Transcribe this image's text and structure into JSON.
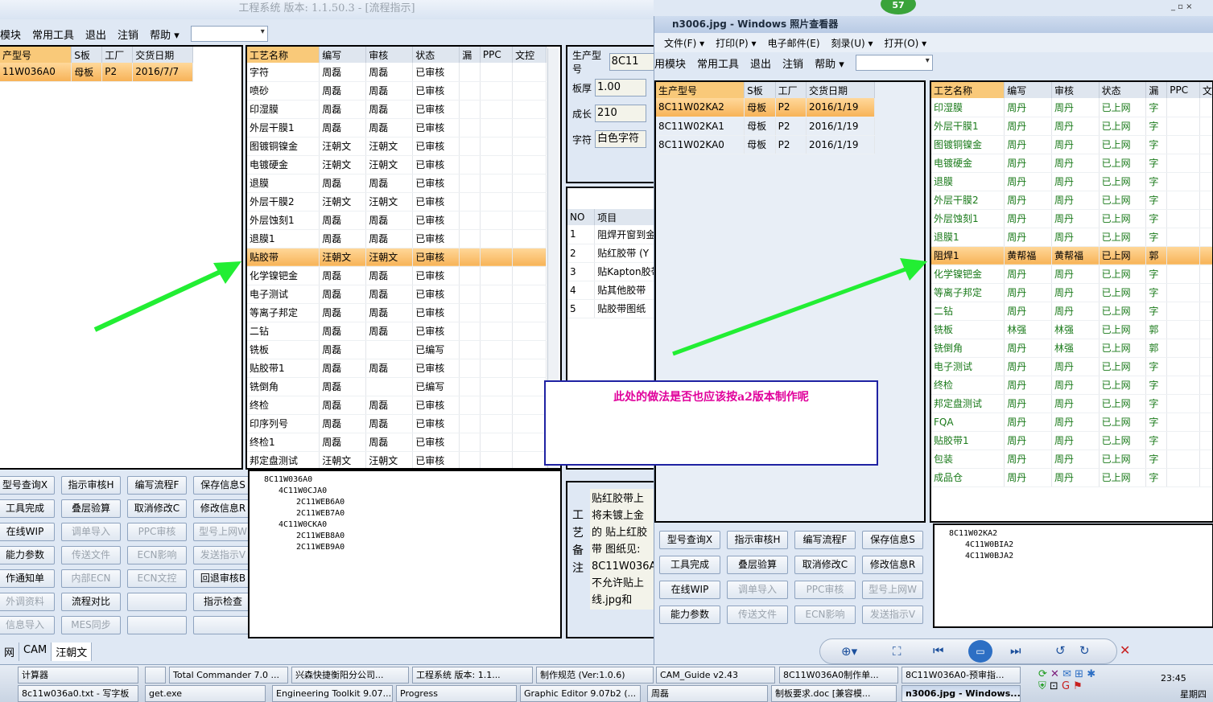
{
  "left_app": {
    "title": "工程系统  版本: 1.1.50.3 - [流程指示]",
    "menu": [
      "模块",
      "常用工具",
      "退出",
      "注销",
      "帮助 ▾"
    ],
    "order_table": {
      "headers": [
        "产型号",
        "S板",
        "工厂",
        "交货日期"
      ],
      "rows": [
        [
          "11W036A0",
          "母板",
          "P2",
          "2016/7/7"
        ]
      ]
    },
    "process_table": {
      "headers": [
        "工艺名称",
        "编写",
        "审核",
        "状态",
        "漏",
        "PPC",
        "文控"
      ],
      "rows": [
        [
          "字符",
          "周磊",
          "周磊",
          "已审核"
        ],
        [
          "喷砂",
          "周磊",
          "周磊",
          "已审核"
        ],
        [
          "印湿膜",
          "周磊",
          "周磊",
          "已审核"
        ],
        [
          "外层干膜1",
          "周磊",
          "周磊",
          "已审核"
        ],
        [
          "图镀铜镍金",
          "汪朝文",
          "汪朝文",
          "已审核"
        ],
        [
          "电镀硬金",
          "汪朝文",
          "汪朝文",
          "已审核"
        ],
        [
          "退膜",
          "周磊",
          "周磊",
          "已审核"
        ],
        [
          "外层干膜2",
          "汪朝文",
          "汪朝文",
          "已审核"
        ],
        [
          "外层蚀刻1",
          "周磊",
          "周磊",
          "已审核"
        ],
        [
          "退膜1",
          "周磊",
          "周磊",
          "已审核"
        ],
        [
          "贴胶带",
          "汪朝文",
          "汪朝文",
          "已审核"
        ],
        [
          "化学镍钯金",
          "周磊",
          "周磊",
          "已审核"
        ],
        [
          "电子测试",
          "周磊",
          "周磊",
          "已审核"
        ],
        [
          "等离子邦定",
          "周磊",
          "周磊",
          "已审核"
        ],
        [
          "二钻",
          "周磊",
          "周磊",
          "已审核"
        ],
        [
          "铣板",
          "周磊",
          "",
          "已编写"
        ],
        [
          "贴胶带1",
          "周磊",
          "周磊",
          "已审核"
        ],
        [
          "铣倒角",
          "周磊",
          "",
          "已编写"
        ],
        [
          "终检",
          "周磊",
          "周磊",
          "已审核"
        ],
        [
          "印序列号",
          "周磊",
          "周磊",
          "已审核"
        ],
        [
          "终检1",
          "周磊",
          "周磊",
          "已审核"
        ],
        [
          "邦定盘测试",
          "汪朝文",
          "汪朝文",
          "已审核"
        ]
      ],
      "selected_index": 10
    },
    "fields": [
      {
        "label": "生产型号",
        "value": "8C11"
      },
      {
        "label": "板厚",
        "value": "1.00"
      },
      {
        "label": "成长",
        "value": "210"
      },
      {
        "label": "字符",
        "value": "白色字符"
      }
    ],
    "items_table": {
      "headers": [
        "NO",
        "项目"
      ],
      "rows": [
        [
          "1",
          "阻焊开窗到金"
        ],
        [
          "2",
          "贴红胶带 (Y"
        ],
        [
          "3",
          "贴Kapton胶带"
        ],
        [
          "4",
          "贴其他胶带"
        ],
        [
          "5",
          "贴胶带图纸"
        ]
      ]
    },
    "note_label": "工艺备注",
    "note_text": "贴红胶带上 将未镀上金的 贴上红胶带 图纸见: 8C11W036A 不允许贴上 线.jpg和",
    "buttons": [
      "型号查询X",
      "指示审核H",
      "编写流程F",
      "保存信息S",
      "工具完成",
      "叠层验算",
      "取消修改C",
      "修改信息R",
      "在线WIP",
      "调单导入",
      "PPC审核",
      "型号上网W",
      "能力参数",
      "传送文件",
      "ECN影响",
      "发送指示V",
      "作通知单",
      "内部ECN",
      "ECN文控",
      "回退审核B",
      "外调资料",
      "流程对比",
      "",
      "指示检查",
      "信息导入",
      "MES同步",
      "",
      ""
    ],
    "tree": [
      "8C11W036A0",
      "4C11W0CJA0",
      "2C11WEB6A0",
      "2C11WEB7A0",
      "4C11W0CKA0",
      "2C11WEB8A0",
      "2C11WEB9A0"
    ],
    "status_tabs": [
      "网",
      "CAM",
      "汪朝文"
    ]
  },
  "viewer": {
    "title": "n3006.jpg - Windows 照片查看器",
    "menu": [
      "文件(F) ▾",
      "打印(P) ▾",
      "电子邮件(E)",
      "刻录(U) ▾",
      "打开(O) ▾"
    ],
    "app_menu": [
      "用模块",
      "常用工具",
      "退出",
      "注销",
      "帮助 ▾"
    ],
    "order_table": {
      "headers": [
        "生产型号",
        "S板",
        "工厂",
        "交货日期"
      ],
      "rows": [
        [
          "8C11W02KA2",
          "母板",
          "P2",
          "2016/1/19"
        ],
        [
          "8C11W02KA1",
          "母板",
          "P2",
          "2016/1/19"
        ],
        [
          "8C11W02KA0",
          "母板",
          "P2",
          "2016/1/19"
        ]
      ]
    },
    "process_table": {
      "headers": [
        "工艺名称",
        "编写",
        "审核",
        "状态",
        "漏",
        "PPC",
        "文"
      ],
      "rows": [
        [
          "印湿膜",
          "周丹",
          "周丹",
          "已上网",
          "字"
        ],
        [
          "外层干膜1",
          "周丹",
          "周丹",
          "已上网",
          "字"
        ],
        [
          "图镀铜镍金",
          "周丹",
          "周丹",
          "已上网",
          "字"
        ],
        [
          "电镀硬金",
          "周丹",
          "周丹",
          "已上网",
          "字"
        ],
        [
          "退膜",
          "周丹",
          "周丹",
          "已上网",
          "字"
        ],
        [
          "外层干膜2",
          "周丹",
          "周丹",
          "已上网",
          "字"
        ],
        [
          "外层蚀刻1",
          "周丹",
          "周丹",
          "已上网",
          "字"
        ],
        [
          "退膜1",
          "周丹",
          "周丹",
          "已上网",
          "字"
        ],
        [
          "阻焊1",
          "黄帮福",
          "黄帮福",
          "已上网",
          "郭"
        ],
        [
          "化学镍钯金",
          "周丹",
          "周丹",
          "已上网",
          "字"
        ],
        [
          "等离子邦定",
          "周丹",
          "周丹",
          "已上网",
          "字"
        ],
        [
          "二钻",
          "周丹",
          "周丹",
          "已上网",
          "字"
        ],
        [
          "铣板",
          "林强",
          "林强",
          "已上网",
          "郭"
        ],
        [
          "铣倒角",
          "周丹",
          "林强",
          "已上网",
          "郭"
        ],
        [
          "电子测试",
          "周丹",
          "周丹",
          "已上网",
          "字"
        ],
        [
          "终检",
          "周丹",
          "周丹",
          "已上网",
          "字"
        ],
        [
          "邦定盘测试",
          "周丹",
          "周丹",
          "已上网",
          "字"
        ],
        [
          "FQA",
          "周丹",
          "周丹",
          "已上网",
          "字"
        ],
        [
          "贴胶带1",
          "周丹",
          "周丹",
          "已上网",
          "字"
        ],
        [
          "包装",
          "周丹",
          "周丹",
          "已上网",
          "字"
        ],
        [
          "成品仓",
          "周丹",
          "周丹",
          "已上网",
          "字"
        ]
      ],
      "selected_index": 8
    },
    "buttons": [
      "型号查询X",
      "指示审核H",
      "编写流程F",
      "保存信息S",
      "工具完成",
      "叠层验算",
      "取消修改C",
      "修改信息R",
      "在线WIP",
      "调单导入",
      "PPC审核",
      "型号上网W",
      "能力参数",
      "传送文件",
      "ECN影响",
      "发送指示V"
    ],
    "tree": [
      "8C11W02KA2",
      "4C11W0BIA2",
      "4C11W0BJA2"
    ]
  },
  "callout_text": "此处的做法是否也应该按a2版本制作呢",
  "badge": "57",
  "taskbar": {
    "row1": [
      "计算器",
      "",
      "Total Commander 7.0 ...",
      "兴森快捷衡阳分公司...",
      "工程系统 版本: 1.1...",
      "制作规范 (Ver:1.0.6)",
      "CAM_Guide v2.43",
      "8C11W036A0制作单...",
      "8C11W036A0-预审指..."
    ],
    "row2": [
      "8c11w036a0.txt - 写字板",
      "get.exe",
      "Engineering Toolkit 9.07...",
      "Progress",
      "Graphic Editor 9.07b2 (...",
      "周磊",
      "制板要求.doc [兼容模...",
      "n3006.jpg - Windows..."
    ],
    "clock": "23:45",
    "day": "星期四"
  },
  "colors": {
    "accent_green": "#22ee33",
    "selection": "#f7b358",
    "callout_border": "#1f22a3",
    "callout_text": "#e0009b",
    "status_green": "#1a7a1a"
  }
}
